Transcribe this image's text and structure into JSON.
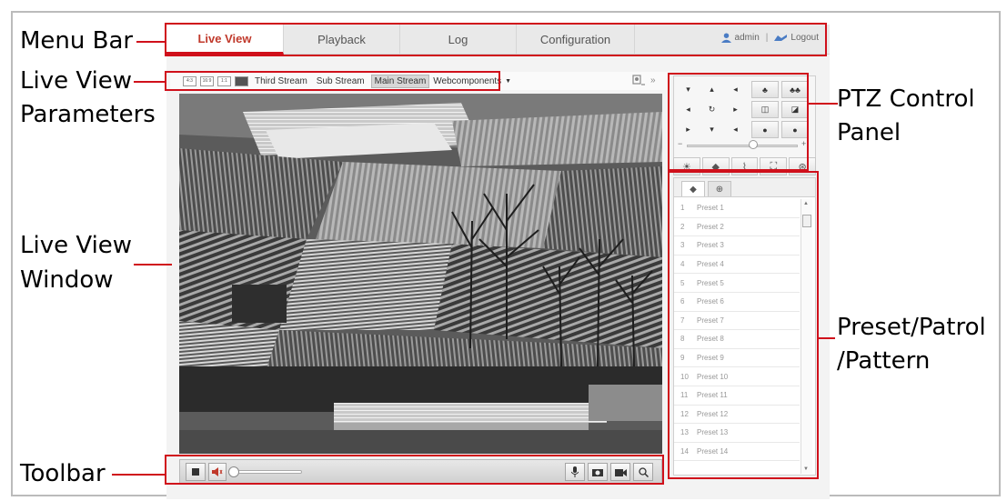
{
  "annotations": {
    "menu_bar": "Menu Bar",
    "live_view_parameters_1": "Live View",
    "live_view_parameters_2": "Parameters",
    "live_view_window_1": "Live View",
    "live_view_window_2": "Window",
    "toolbar": "Toolbar",
    "ptz_1": "PTZ Control",
    "ptz_2": "Panel",
    "preset_1": "Preset/Patrol",
    "preset_2": "/Pattern"
  },
  "menu": {
    "tabs": [
      {
        "label": "Live View",
        "active": true
      },
      {
        "label": "Playback",
        "active": false
      },
      {
        "label": "Log",
        "active": false
      },
      {
        "label": "Configuration",
        "active": false
      }
    ],
    "user": "admin",
    "separator": "|",
    "logout": "Logout"
  },
  "params": {
    "ratios": [
      "4:3",
      "16:9",
      "1:1",
      ""
    ],
    "streams": [
      {
        "label": "Third Stream",
        "active": false
      },
      {
        "label": "Sub Stream",
        "active": false
      },
      {
        "label": "Main Stream",
        "active": true
      }
    ],
    "plugin": "Webcomponents",
    "expand": "»"
  },
  "ptz": {
    "directions": [
      "▾",
      "▴",
      "◂",
      "◂",
      "↻",
      "▸",
      "▸",
      "▾",
      "◂"
    ],
    "zoom_buttons": [
      "♣",
      "♣♣",
      "◫",
      "◪",
      "●",
      "●"
    ],
    "speed_min": "−",
    "speed_max": "+",
    "speed_level": 0.6,
    "functions": [
      "☀",
      "◆",
      "⌇",
      "⛶",
      "⊛"
    ]
  },
  "presets": {
    "tabs": [
      "◆",
      "⊕"
    ],
    "items": [
      {
        "num": "1",
        "name": "Preset 1"
      },
      {
        "num": "2",
        "name": "Preset 2"
      },
      {
        "num": "3",
        "name": "Preset 3"
      },
      {
        "num": "4",
        "name": "Preset 4"
      },
      {
        "num": "5",
        "name": "Preset 5"
      },
      {
        "num": "6",
        "name": "Preset 6"
      },
      {
        "num": "7",
        "name": "Preset 7"
      },
      {
        "num": "8",
        "name": "Preset 8"
      },
      {
        "num": "9",
        "name": "Preset 9"
      },
      {
        "num": "10",
        "name": "Preset 10"
      },
      {
        "num": "11",
        "name": "Preset 11"
      },
      {
        "num": "12",
        "name": "Preset 12"
      },
      {
        "num": "13",
        "name": "Preset 13"
      },
      {
        "num": "14",
        "name": "Preset 14"
      }
    ]
  },
  "toolbar": {
    "stop_icon": "stop-icon",
    "volume_icon": "speaker-icon",
    "volume_level": 0,
    "right_icons": [
      "microphone-icon",
      "camera-icon",
      "record-icon",
      "zoom-icon"
    ]
  },
  "colors": {
    "annotation_red": "#d0101b",
    "active_tab_text": "#c0392b"
  }
}
